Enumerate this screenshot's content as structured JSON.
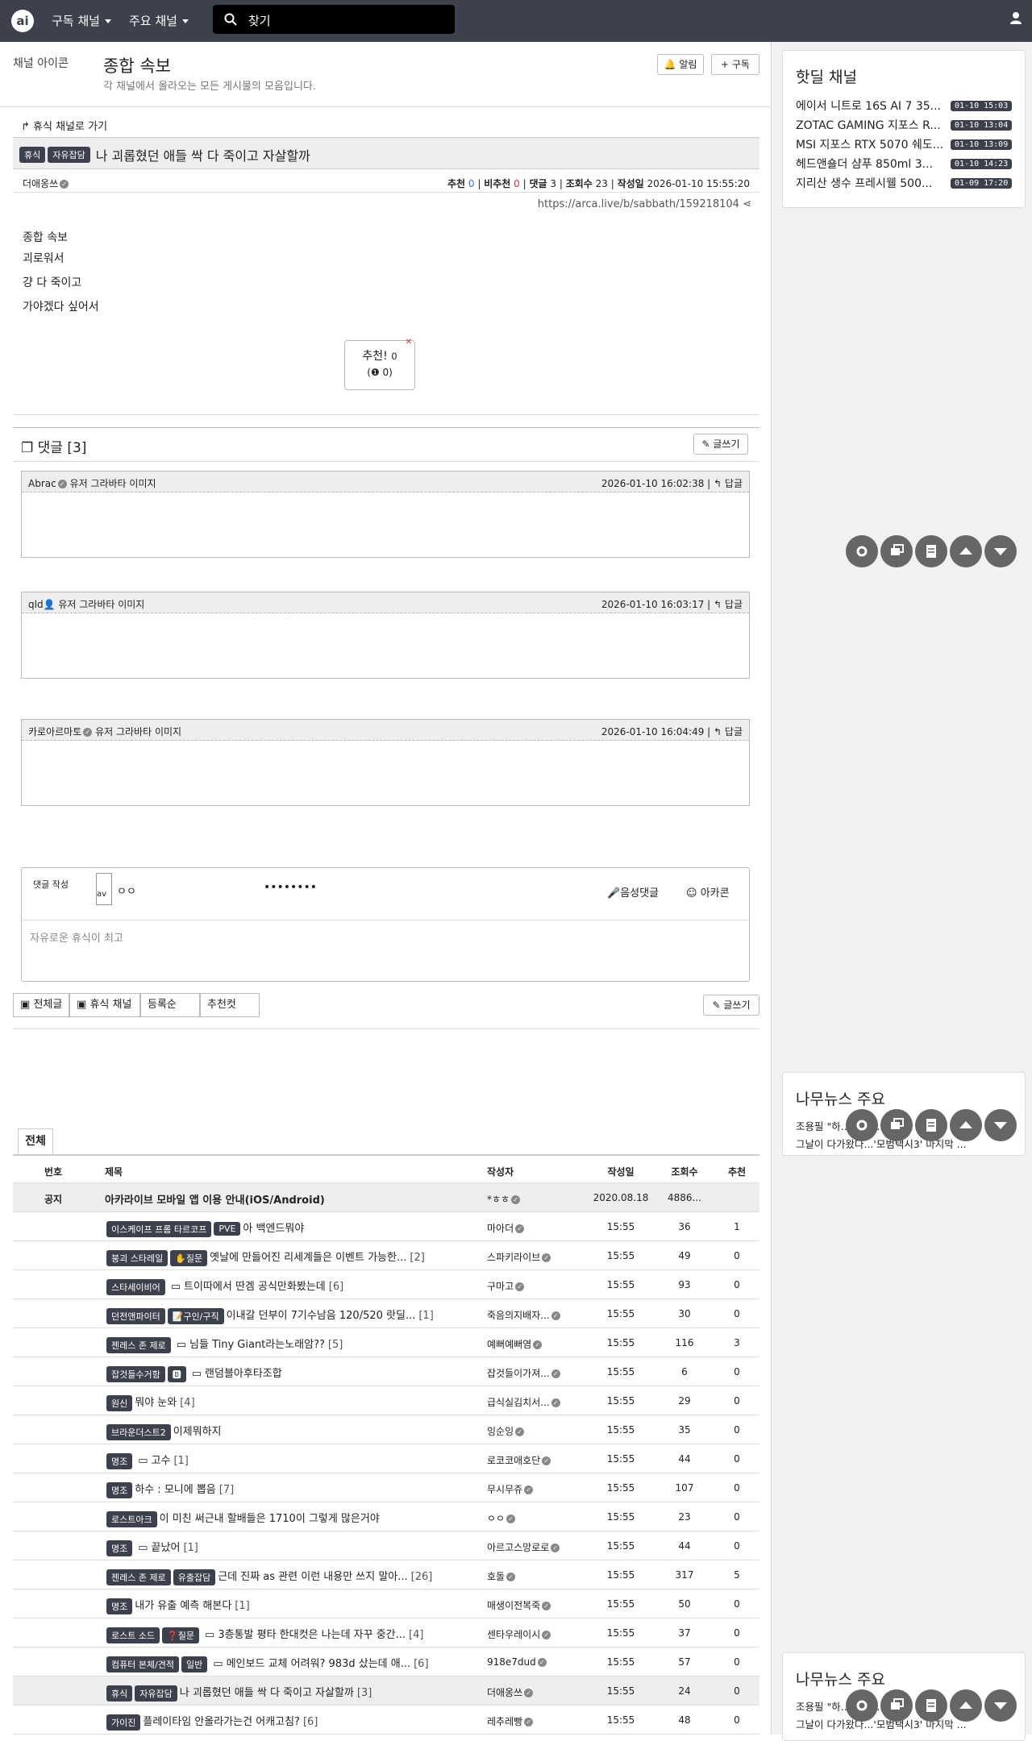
{
  "nav": {
    "logo": "ai",
    "menu1": "구독 채널",
    "menu2": "주요 채널",
    "search": "찾기"
  },
  "header": {
    "icon_alt": "채널 아이콘",
    "title": "종합 속보",
    "desc": "각 채널에서 올라오는 모든 게시물의 모음입니다.",
    "alarm": "알림",
    "subscribe": "구독"
  },
  "post": {
    "back": "휴식 채널로 가기",
    "badges": [
      "휴식",
      "자유잡담"
    ],
    "title": "나 괴롭혔던 애들 싹 다 죽이고 자살할까",
    "author": "더애옹쓰",
    "rec_label": "추천",
    "rec": "0",
    "unrec_label": "비추천",
    "unrec": "0",
    "cmt_label": "댓글",
    "cmt": "3",
    "view_label": "조회수",
    "view": "23",
    "date_label": "작성일",
    "date": "2026-01-10 15:55:20",
    "url": "https://arca.live/b/sabbath/159218104",
    "img_alt": "종합 속보",
    "lines": [
      "괴로워서",
      "걍 다 죽이고",
      "가야겠다 싶어서"
    ],
    "vote_label": "추천!",
    "vote_count": "0",
    "vote_sub": "0"
  },
  "comments": {
    "header": "댓글 [3]",
    "write": "글쓰기",
    "reply": "답글",
    "avatar_alt": "유저 그라바타 이미지",
    "items": [
      {
        "author": "Abrac",
        "time": "2026-01-10 16:02:38"
      },
      {
        "author": "qld",
        "time": "2026-01-10 16:03:17"
      },
      {
        "author": "카로아르마토",
        "time": "2026-01-10 16:04:49"
      }
    ]
  },
  "writebox": {
    "label": "댓글 작성",
    "avatar": "av",
    "nick": "ㅇㅇ",
    "pw": "••••••••",
    "voice": "음성댓글",
    "arcacon": "아카콘",
    "placeholder": "자유로운 휴식이 최고"
  },
  "filters": {
    "all": "전체글",
    "channel": "휴식 채널",
    "order": "등록순",
    "best": "추천컷",
    "write": "글쓰기"
  },
  "board": {
    "tab": "전체",
    "cols": [
      "번호",
      "제목",
      "작성자",
      "작성일",
      "조회수",
      "추천"
    ],
    "notice": {
      "num": "공지",
      "title": "아카라이브 모바일 앱 이용 안내(iOS/Android)",
      "author": "*ㅎㅎ",
      "date": "2020.08.18",
      "views": "4886..."
    },
    "rows": [
      {
        "b": [
          "이스케이프 프롬 타르코프",
          "PVE"
        ],
        "t": "아 백엔드뭐야",
        "c": "",
        "a": "마아더",
        "d": "15:55",
        "v": "36",
        "r": "1",
        "img": false
      },
      {
        "b": [
          "붕괴 스타레일",
          "✋질문"
        ],
        "t": "옛날에 만들어진 리세계들은 이벤트 가능한...",
        "c": "[2]",
        "a": "스파키라이브",
        "d": "15:55",
        "v": "49",
        "r": "0",
        "img": false
      },
      {
        "b": [
          "스타세이비어"
        ],
        "t": "트이따에서 딴겜 공식만화봤는데",
        "c": "[6]",
        "a": "구마고",
        "d": "15:55",
        "v": "93",
        "r": "0",
        "img": true
      },
      {
        "b": [
          "던전앤파이터",
          "📝구인/구직"
        ],
        "t": "이내갈 던부이 7기수남음 120/520 랏딜...",
        "c": "[1]",
        "a": "죽음의지배자...",
        "d": "15:55",
        "v": "30",
        "r": "0",
        "img": false
      },
      {
        "b": [
          "젠레스 존 제로"
        ],
        "t": "님들 Tiny Giant라는노래암??",
        "c": "[5]",
        "a": "예뻐예뻐염",
        "d": "15:55",
        "v": "116",
        "r": "3",
        "img": true
      },
      {
        "b": [
          "잡것들수거함",
          "🅱"
        ],
        "t": "랜덤블아후타조합",
        "c": "",
        "a": "잡것들이가져...",
        "d": "15:55",
        "v": "6",
        "r": "0",
        "img": true
      },
      {
        "b": [
          "원신"
        ],
        "t": "뭐야 눈와",
        "c": "[4]",
        "a": "급식실김치서...",
        "d": "15:55",
        "v": "29",
        "r": "0",
        "img": false
      },
      {
        "b": [
          "브라운더스트2"
        ],
        "t": "이제뭐하지",
        "c": "",
        "a": "잉순잉",
        "d": "15:55",
        "v": "35",
        "r": "0",
        "img": false
      },
      {
        "b": [
          "명조"
        ],
        "t": "고수",
        "c": "[1]",
        "a": "로코코애호단",
        "d": "15:55",
        "v": "44",
        "r": "0",
        "img": true
      },
      {
        "b": [
          "명조"
        ],
        "t": "하수 : 모니에 뽑음",
        "c": "[7]",
        "a": "무시무쥬",
        "d": "15:55",
        "v": "107",
        "r": "0",
        "img": false
      },
      {
        "b": [
          "로스트아크"
        ],
        "t": "이 미친 써근내 할배들은 1710이 그렇게 많은거야",
        "c": "",
        "a": "ㅇㅇ",
        "d": "15:55",
        "v": "23",
        "r": "0",
        "img": false
      },
      {
        "b": [
          "명조"
        ],
        "t": "끝났어",
        "c": "[1]",
        "a": "아르고스망로로",
        "d": "15:55",
        "v": "44",
        "r": "0",
        "img": true
      },
      {
        "b": [
          "젠레스 존 제로",
          "유출잡담"
        ],
        "t": "근데 진짜 as 관련 이런 내용만 쓰지 말아...",
        "c": "[26]",
        "a": "호돌",
        "d": "15:55",
        "v": "317",
        "r": "5",
        "img": false
      },
      {
        "b": [
          "명조"
        ],
        "t": "내가 유출 예측 해본다",
        "c": "[1]",
        "a": "매생이전복죽",
        "d": "15:55",
        "v": "50",
        "r": "0",
        "img": false
      },
      {
        "b": [
          "로스트 소드",
          "❓질문"
        ],
        "t": "3층통발 평타 한대컷은 나는데 자꾸 중간...",
        "c": "[4]",
        "a": "센타우레이시",
        "d": "15:55",
        "v": "37",
        "r": "0",
        "img": true
      },
      {
        "b": [
          "컴퓨터 본체/견적",
          "일반"
        ],
        "t": "메인보드 교체 어려워? 983d 샀는데 애...",
        "c": "[6]",
        "a": "918e7dud",
        "d": "15:55",
        "v": "57",
        "r": "0",
        "img": true
      },
      {
        "b": [
          "휴식",
          "자유잡담"
        ],
        "t": "나 괴롭혔던 애들 싹 다 죽이고 자살할까",
        "c": "[3]",
        "a": "더애옹쓰",
        "d": "15:55",
        "v": "24",
        "r": "0",
        "img": false,
        "hl": true
      },
      {
        "b": [
          "가이진"
        ],
        "t": "플레이타임 안올라가는건 어캐고침?",
        "c": "[6]",
        "a": "레추레빵",
        "d": "15:55",
        "v": "48",
        "r": "0",
        "img": false
      }
    ]
  },
  "side": {
    "hot_title": "핫딜 채널",
    "hot": [
      {
        "t": "에이서 니트로 16S AI 7 35...",
        "time": "01-10 15:03"
      },
      {
        "t": "ZOTAC GAMING 지포스 R...",
        "time": "01-10 13:04"
      },
      {
        "t": "MSI 지포스 RTX 5070 쉐도...",
        "time": "01-10 13:09"
      },
      {
        "t": "헤드앤숄더 샴푸 850ml 3...",
        "time": "01-10 14:23"
      },
      {
        "t": "지리산 생수 프레시웰 500...",
        "time": "01-09 17:20"
      }
    ],
    "news_title": "나무뉴스 주요",
    "news": [
      "조용필 \"하...\" 신곡...",
      "그날이 다가왔다...'모범택시3' 마지막 ..."
    ]
  }
}
